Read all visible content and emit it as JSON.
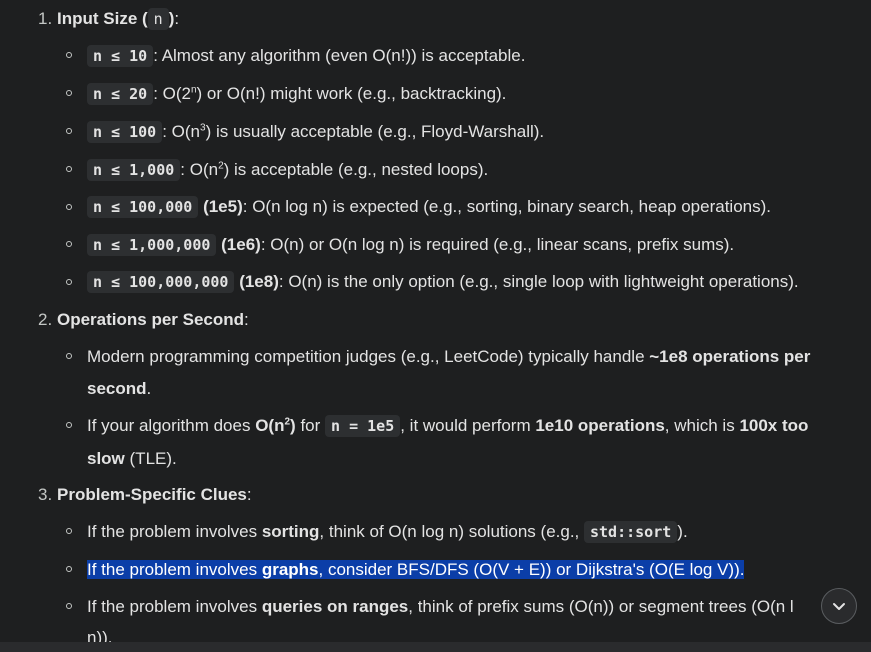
{
  "sections": [
    {
      "num": "1.",
      "title": "Input Size",
      "code": "n",
      "tail": ":"
    },
    {
      "num": "2.",
      "title": "Operations per Second",
      "tail": ":"
    },
    {
      "num": "3.",
      "title": "Problem-Specific Clues",
      "tail": ":"
    }
  ],
  "input_size": [
    {
      "code": "n ≤ 10",
      "text": ": Almost any algorithm (even O(n!)) is acceptable."
    },
    {
      "code": "n ≤ 20",
      "pre": ": O(2",
      "sup": "n",
      "post": ") or O(n!) might work (e.g., backtracking)."
    },
    {
      "code": "n ≤ 100",
      "pre": ": O(n",
      "sup": "3",
      "post": ") is usually acceptable (e.g., Floyd-Warshall)."
    },
    {
      "code": "n ≤ 1,000",
      "pre": ": O(n",
      "sup": "2",
      "post": ") is acceptable (e.g., nested loops)."
    },
    {
      "code": "n ≤ 100,000",
      "bold": " (1e5)",
      "text": ": O(n log n) is expected (e.g., sorting, binary search, heap operations)."
    },
    {
      "code": "n ≤ 1,000,000",
      "bold": " (1e6)",
      "text": ": O(n) or O(n log n) is required (e.g., linear scans, prefix sums)."
    },
    {
      "code": "n ≤ 100,000,000",
      "bold": " (1e8)",
      "text": ": O(n) is the only option (e.g., single loop with lightweight operations)."
    }
  ],
  "ops": {
    "b1_l1_text": "Modern programming competition judges (e.g., LeetCode) typically handle ",
    "b1_l1_bold": "~1e8 operations per",
    "b1_l2_bold": "second",
    "b1_l2_text": ".",
    "b2_l1_a": "If your algorithm does ",
    "b2_l1_bold_a": "O(n",
    "b2_l1_sup": "2",
    "b2_l1_bold_b": ")",
    "b2_l1_b": " for ",
    "b2_l1_code": "n = 1e5",
    "b2_l1_c": ", it would perform ",
    "b2_l1_bold_c": "1e10 operations",
    "b2_l1_d": ", which is ",
    "b2_l1_bold_d": "100x too",
    "b2_l2_bold": "slow",
    "b2_l2_text": " (TLE)."
  },
  "clues": {
    "c1_a": "If the problem involves ",
    "c1_bold": "sorting",
    "c1_b": ", think of O(n log n) solutions (e.g., ",
    "c1_code": "std::sort",
    "c1_c": ").",
    "c2_a": "If the problem involves ",
    "c2_bold": "graphs",
    "c2_b": ", consider BFS/DFS (O(V + E)) or Dijkstra's (O(E log V)).",
    "c3_a": "If the problem involves ",
    "c3_bold": "queries on ranges",
    "c3_b": ", think of prefix sums (O(n)) or segment trees (O(n l",
    "c3_l2": "n))."
  },
  "icons": {
    "scroll_down": "chevron-down-icon"
  }
}
